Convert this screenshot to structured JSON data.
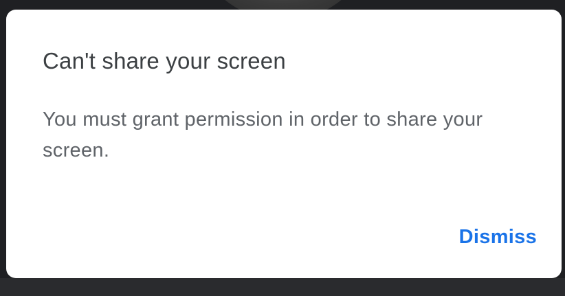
{
  "dialog": {
    "title": "Can't share your screen",
    "message": "You must grant permission in order to share your screen.",
    "dismiss_label": "Dismiss"
  },
  "colors": {
    "title": "#3c4043",
    "message": "#5f6368",
    "accent": "#1a73e8",
    "dialog_bg": "#ffffff",
    "backdrop": "#1f2023"
  }
}
